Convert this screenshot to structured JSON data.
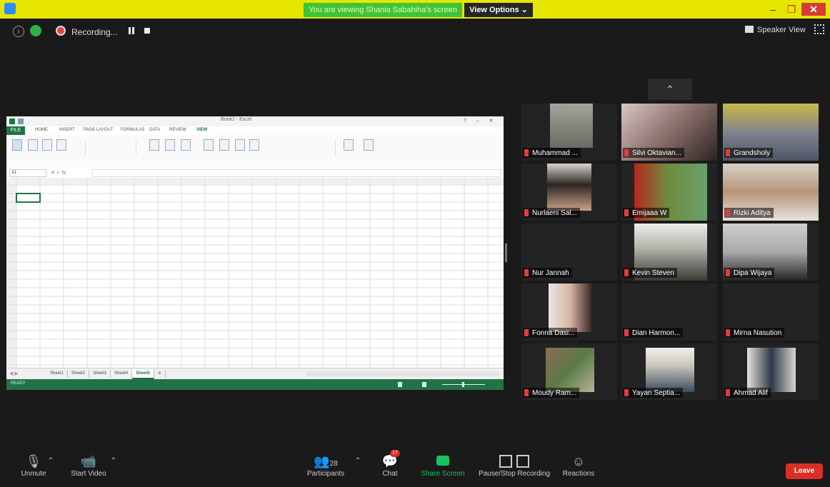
{
  "window": {
    "share_banner": "You are viewing Shania Sabahiha's screen",
    "view_options": "View Options ⌄",
    "minimize": "–",
    "maximize": "❐",
    "close": "✕"
  },
  "meeting_bar": {
    "recording_label": "Recording...",
    "speaker_view": "Speaker View"
  },
  "excel": {
    "doc_title": "Book1 - Excel",
    "tabs": [
      "FILE",
      "HOME",
      "INSERT",
      "PAGE LAYOUT",
      "FORMULAS",
      "DATA",
      "REVIEW",
      "VIEW"
    ],
    "name_box": "A1",
    "sheet_tabs": [
      "Sheet1",
      "Sheet2",
      "Sheet3",
      "Sheet4",
      "Sheet5"
    ],
    "active_sheet": "Sheet5",
    "status": "READY"
  },
  "participants": [
    {
      "name": "Muhammad ..."
    },
    {
      "name": "Silvi Oktavian..."
    },
    {
      "name": "Grandsholy"
    },
    {
      "name": "Nurlaeni Sal..."
    },
    {
      "name": "Emijaaa W"
    },
    {
      "name": "Rizki Aditya"
    },
    {
      "name": "Nur Jannah"
    },
    {
      "name": "Kevin Steven"
    },
    {
      "name": "Dipa Wijaya"
    },
    {
      "name": "Fonna Dasi..."
    },
    {
      "name": "Dian Harmon..."
    },
    {
      "name": "Mirna Nasution"
    },
    {
      "name": "Moudy Ram..."
    },
    {
      "name": "Yayan Septia..."
    },
    {
      "name": "Ahmad Alif"
    }
  ],
  "toolbar": {
    "unmute": "Unmute",
    "start_video": "Start Video",
    "participants": "Participants",
    "participants_count": "28",
    "chat": "Chat",
    "chat_badge": "17",
    "share_screen": "Share Screen",
    "pause_recording": "Pause/Stop Recording",
    "reactions": "Reactions",
    "leave": "Leave"
  },
  "colors": {
    "titlebar": "#e6e600",
    "share_banner": "#3ec43a",
    "excel_green": "#217346",
    "leave_red": "#d93025"
  }
}
